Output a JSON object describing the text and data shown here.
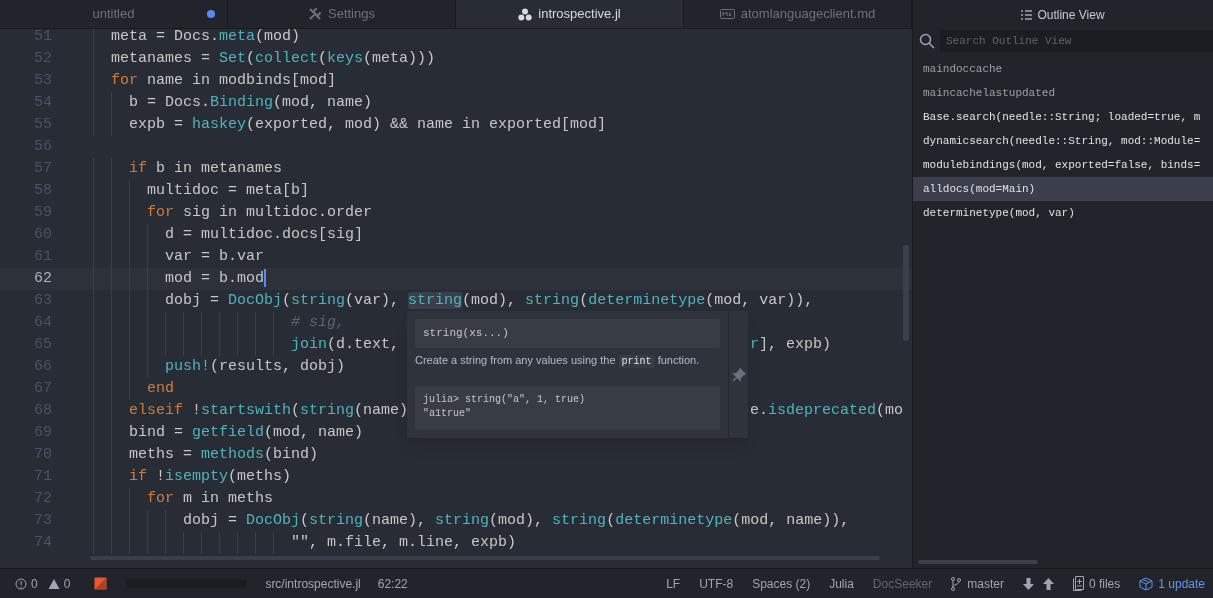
{
  "tabs": [
    {
      "label": "untitled",
      "selected": false,
      "modified": true
    },
    {
      "label": "Settings",
      "selected": false,
      "modified": false
    },
    {
      "label": "introspective.jl",
      "selected": true,
      "modified": false
    },
    {
      "label": "atomlanguageclient.md",
      "selected": false,
      "modified": false
    }
  ],
  "editor": {
    "lines": [
      {
        "number": "51",
        "current": false,
        "tokens": [
          {
            "kind": "plain",
            "text": "meta = Docs."
          },
          {
            "kind": "fn",
            "text": "meta"
          },
          {
            "kind": "plain",
            "text": "(mod)"
          }
        ]
      },
      {
        "number": "52",
        "current": false,
        "tokens": [
          {
            "kind": "plain",
            "text": "metanames = "
          },
          {
            "kind": "fn",
            "text": "Set"
          },
          {
            "kind": "plain",
            "text": "("
          },
          {
            "kind": "fn",
            "text": "collect"
          },
          {
            "kind": "plain",
            "text": "("
          },
          {
            "kind": "fn",
            "text": "keys"
          },
          {
            "kind": "plain",
            "text": "(meta)))"
          }
        ]
      },
      {
        "number": "53",
        "current": false,
        "tokens": [
          {
            "kind": "kw",
            "text": "for"
          },
          {
            "kind": "plain",
            "text": " name in modbinds[mod]"
          }
        ]
      },
      {
        "number": "54",
        "current": false,
        "tokens": [
          {
            "kind": "plain",
            "text": "b = Docs."
          },
          {
            "kind": "fn",
            "text": "Binding"
          },
          {
            "kind": "plain",
            "text": "(mod, name)"
          }
        ]
      },
      {
        "number": "55",
        "current": false,
        "tokens": [
          {
            "kind": "plain",
            "text": "expb = "
          },
          {
            "kind": "fn",
            "text": "haskey"
          },
          {
            "kind": "plain",
            "text": "(exported, mod) && name in exported[mod]"
          }
        ]
      },
      {
        "number": "56",
        "current": false
      },
      {
        "number": "57",
        "current": false,
        "tokens": [
          {
            "kind": "kw",
            "text": "if"
          },
          {
            "kind": "plain",
            "text": " b in metanames"
          }
        ]
      },
      {
        "number": "58",
        "current": false,
        "tokens": [
          {
            "kind": "plain",
            "text": "multidoc = meta[b]"
          }
        ]
      },
      {
        "number": "59",
        "current": false,
        "tokens": [
          {
            "kind": "kw",
            "text": "for"
          },
          {
            "kind": "plain",
            "text": " sig in multidoc.order"
          }
        ]
      },
      {
        "number": "60",
        "current": false,
        "tokens": [
          {
            "kind": "plain",
            "text": "d = multidoc.docs[sig]"
          }
        ]
      },
      {
        "number": "61",
        "current": false,
        "tokens": [
          {
            "kind": "plain",
            "text": "var = b.var"
          }
        ]
      },
      {
        "number": "62",
        "current": true,
        "tokens": [
          {
            "kind": "plain",
            "text": "mod = b.mod"
          }
        ]
      },
      {
        "number": "63",
        "current": false,
        "tokens": [
          {
            "kind": "plain",
            "text": "dobj = "
          },
          {
            "kind": "fn",
            "text": "DocObj"
          },
          {
            "kind": "plain",
            "text": "("
          },
          {
            "kind": "fn",
            "text": "string"
          },
          {
            "kind": "plain",
            "text": "(var), "
          },
          {
            "kind": "fn",
            "text": "string",
            "hovered": true
          },
          {
            "kind": "plain",
            "text": "(mod), "
          },
          {
            "kind": "fn",
            "text": "string"
          },
          {
            "kind": "plain",
            "text": "("
          },
          {
            "kind": "fn",
            "text": "determinetype"
          },
          {
            "kind": "plain",
            "text": "(mod, var)),"
          }
        ]
      },
      {
        "number": "64",
        "current": false,
        "tokens": [
          {
            "kind": "comment",
            "text": "# sig,"
          }
        ]
      },
      {
        "number": "65",
        "current": false,
        "tokens": [
          {
            "kind": "fn",
            "text": "join"
          },
          {
            "kind": "plain",
            "text": "(d.text, "
          }
        ],
        "after_popup": [
          {
            "kind": "fn",
            "text": "r"
          },
          {
            "kind": "plain",
            "text": "], expb)"
          }
        ]
      },
      {
        "number": "66",
        "current": false,
        "tokens": [
          {
            "kind": "fn",
            "text": "push!"
          },
          {
            "kind": "plain",
            "text": "(results, dobj)"
          }
        ]
      },
      {
        "number": "67",
        "current": false,
        "tokens": [
          {
            "kind": "kw",
            "text": "end"
          }
        ]
      },
      {
        "number": "68",
        "current": false,
        "tokens": [
          {
            "kind": "kw",
            "text": "elseif"
          },
          {
            "kind": "plain",
            "text": " !"
          },
          {
            "kind": "fn",
            "text": "startswith"
          },
          {
            "kind": "plain",
            "text": "("
          },
          {
            "kind": "fn",
            "text": "string"
          },
          {
            "kind": "plain",
            "text": "(name)"
          }
        ],
        "after_popup": [
          {
            "kind": "plain",
            "text": "e."
          },
          {
            "kind": "fn",
            "text": "isdeprecated"
          },
          {
            "kind": "plain",
            "text": "(mo"
          }
        ]
      },
      {
        "number": "69",
        "current": false,
        "tokens": [
          {
            "kind": "plain",
            "text": "bind = "
          },
          {
            "kind": "fn",
            "text": "getfield"
          },
          {
            "kind": "plain",
            "text": "(mod, name)"
          }
        ]
      },
      {
        "number": "70",
        "current": false,
        "tokens": [
          {
            "kind": "plain",
            "text": "meths = "
          },
          {
            "kind": "fn",
            "text": "methods"
          },
          {
            "kind": "plain",
            "text": "(bind)"
          }
        ]
      },
      {
        "number": "71",
        "current": false,
        "tokens": [
          {
            "kind": "kw",
            "text": "if"
          },
          {
            "kind": "plain",
            "text": " !"
          },
          {
            "kind": "fn",
            "text": "isempty"
          },
          {
            "kind": "plain",
            "text": "(meths)"
          }
        ]
      },
      {
        "number": "72",
        "current": false,
        "tokens": [
          {
            "kind": "kw",
            "text": "for"
          },
          {
            "kind": "plain",
            "text": " m in meths"
          }
        ]
      },
      {
        "number": "73",
        "current": false,
        "tokens": [
          {
            "kind": "plain",
            "text": "dobj = "
          },
          {
            "kind": "fn",
            "text": "DocObj"
          },
          {
            "kind": "plain",
            "text": "("
          },
          {
            "kind": "fn",
            "text": "string"
          },
          {
            "kind": "plain",
            "text": "(name), "
          },
          {
            "kind": "fn",
            "text": "string"
          },
          {
            "kind": "plain",
            "text": "(mod), "
          },
          {
            "kind": "fn",
            "text": "string"
          },
          {
            "kind": "plain",
            "text": "("
          },
          {
            "kind": "fn",
            "text": "determinetype"
          },
          {
            "kind": "plain",
            "text": "(mod, name)),"
          }
        ]
      },
      {
        "number": "74",
        "current": false,
        "tokens": [
          {
            "kind": "plain",
            "text": "\"\", m.file, m.line, expb)"
          }
        ]
      }
    ]
  },
  "popup": {
    "signature": "string(xs...)",
    "description": [
      {
        "kind": "text",
        "text": "Create a string from any values using the "
      },
      {
        "kind": "code",
        "text": "print"
      },
      {
        "kind": "text",
        "text": " function."
      }
    ],
    "example": [
      "julia> string(\"a\", 1, true)",
      "\"a1true\""
    ]
  },
  "outline": {
    "title": "Outline View",
    "search": {
      "placeholder": "Search Outline View"
    },
    "items": [
      {
        "label": "maindoccache",
        "kind": "variable",
        "selected": false
      },
      {
        "label": "maincachelastupdated",
        "kind": "variable",
        "selected": false
      },
      {
        "label": "Base.search(needle::String; loaded=true, m",
        "kind": "function",
        "selected": false
      },
      {
        "label": "dynamicsearch(needle::String, mod::Module=",
        "kind": "function",
        "selected": false
      },
      {
        "label": "modulebindings(mod, exported=false, binds=",
        "kind": "function",
        "selected": false
      },
      {
        "label": "alldocs(mod=Main)",
        "kind": "function",
        "selected": true
      },
      {
        "label": "determinetype(mod, var)",
        "kind": "function",
        "selected": false
      }
    ]
  },
  "status_bar": {
    "errors": "0",
    "warnings": "0",
    "progress": {
      "level": 0
    },
    "file": "src/introspective.jl",
    "position": "62:22",
    "right": [
      {
        "kind": "text",
        "label": "LF",
        "dim": false
      },
      {
        "kind": "text",
        "label": "UTF-8",
        "dim": false
      },
      {
        "kind": "text",
        "label": "Spaces (2)",
        "dim": false
      },
      {
        "kind": "text",
        "label": "Julia",
        "dim": false
      },
      {
        "kind": "text",
        "label": "DocSeeker",
        "dim": true
      },
      {
        "kind": "branch",
        "label": "master"
      },
      {
        "kind": "fetch"
      },
      {
        "kind": "files",
        "label": "0 files"
      },
      {
        "kind": "update",
        "label": "1 update"
      }
    ]
  }
}
